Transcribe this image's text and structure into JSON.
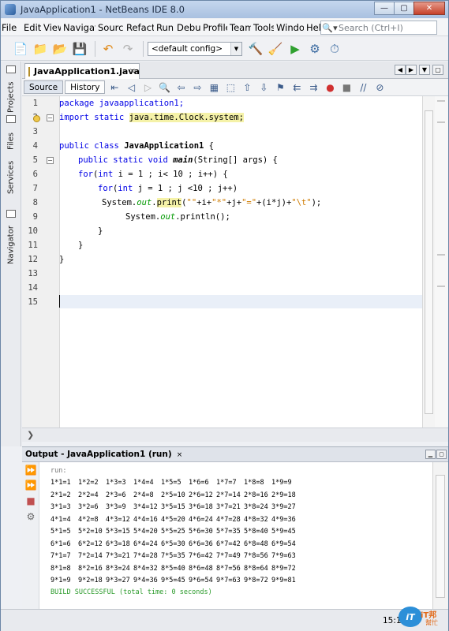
{
  "window": {
    "title": "JavaApplication1 - NetBeans IDE 8.0",
    "controls": [
      "—",
      "▢",
      "✕"
    ]
  },
  "menu": [
    "File",
    "Edit",
    "View",
    "Navigate",
    "Source",
    "Refactor",
    "Run",
    "Debug",
    "Profile",
    "Team",
    "Tools",
    "Window",
    "Help"
  ],
  "search": {
    "placeholder": "Search (Ctrl+I)"
  },
  "toolbar": {
    "config": "<default config>"
  },
  "side_tabs": [
    "Projects",
    "Files",
    "Services",
    "Navigator"
  ],
  "editor": {
    "file_tab": "JavaApplication1.java",
    "source_btn": "Source",
    "history_btn": "History",
    "line_numbers": [
      "1",
      "2",
      "3",
      "4",
      "5",
      "6",
      "7",
      "8",
      "9",
      "10",
      "11",
      "12",
      "13",
      "14",
      "15"
    ],
    "code": {
      "l1": "package javaapplication1;",
      "l2_kw": "import static ",
      "l2_rest": "java.time.Clock.system;",
      "l4_kw": "public class ",
      "l4_cls": "JavaApplication1",
      "l4_rest": " {",
      "l5_kw": "public static void ",
      "l5_m": "main",
      "l5_rest": "(String[] args) {",
      "l6_kw": "for",
      "l6_p": "(",
      "l6_kw2": "int",
      "l6_rest": " i = 1 ; i< 10 ; i++) {",
      "l7_kw": "for",
      "l7_p": "(",
      "l7_kw2": "int",
      "l7_rest": " j = 1 ; j <10 ; j++)",
      "l8_a": "System.",
      "l8_out": "out",
      "l8_dot": ".",
      "l8_print": "print",
      "l8_b": "(",
      "l8_s1": "\"\"",
      "l8_c": "+i+",
      "l8_s2": "\"*\"",
      "l8_d": "+j+",
      "l8_s3": "\"=\"",
      "l8_e": "+(i*j)+",
      "l8_s4": "\"\\t\"",
      "l8_f": ");",
      "l9_a": "System.",
      "l9_out": "out",
      "l9_b": ".println();",
      "l10": "}",
      "l11": "}",
      "l12": "}"
    }
  },
  "output": {
    "title": "Output - JavaApplication1 (run)",
    "run_label": "run:",
    "rows": [
      [
        "1*1=1",
        "1*2=2",
        "1*3=3",
        "1*4=4",
        "1*5=5",
        "1*6=6",
        "1*7=7",
        "1*8=8",
        "1*9=9"
      ],
      [
        "2*1=2",
        "2*2=4",
        "2*3=6",
        "2*4=8",
        "2*5=10",
        "2*6=12",
        "2*7=14",
        "2*8=16",
        "2*9=18"
      ],
      [
        "3*1=3",
        "3*2=6",
        "3*3=9",
        "3*4=12",
        "3*5=15",
        "3*6=18",
        "3*7=21",
        "3*8=24",
        "3*9=27"
      ],
      [
        "4*1=4",
        "4*2=8",
        "4*3=12",
        "4*4=16",
        "4*5=20",
        "4*6=24",
        "4*7=28",
        "4*8=32",
        "4*9=36"
      ],
      [
        "5*1=5",
        "5*2=10",
        "5*3=15",
        "5*4=20",
        "5*5=25",
        "5*6=30",
        "5*7=35",
        "5*8=40",
        "5*9=45"
      ],
      [
        "6*1=6",
        "6*2=12",
        "6*3=18",
        "6*4=24",
        "6*5=30",
        "6*6=36",
        "6*7=42",
        "6*8=48",
        "6*9=54"
      ],
      [
        "7*1=7",
        "7*2=14",
        "7*3=21",
        "7*4=28",
        "7*5=35",
        "7*6=42",
        "7*7=49",
        "7*8=56",
        "7*9=63"
      ],
      [
        "8*1=8",
        "8*2=16",
        "8*3=24",
        "8*4=32",
        "8*5=40",
        "8*6=48",
        "8*7=56",
        "8*8=64",
        "8*9=72"
      ],
      [
        "9*1=9",
        "9*2=18",
        "9*3=27",
        "9*4=36",
        "9*5=45",
        "9*6=54",
        "9*7=63",
        "9*8=72",
        "9*9=81"
      ]
    ],
    "build": "BUILD SUCCESSFUL (total time: 0 seconds)"
  },
  "status": {
    "cursor": "15:1",
    "logo_brand": "iT邦",
    "logo_sub": "幫忙",
    "logo_mark": "iT"
  }
}
